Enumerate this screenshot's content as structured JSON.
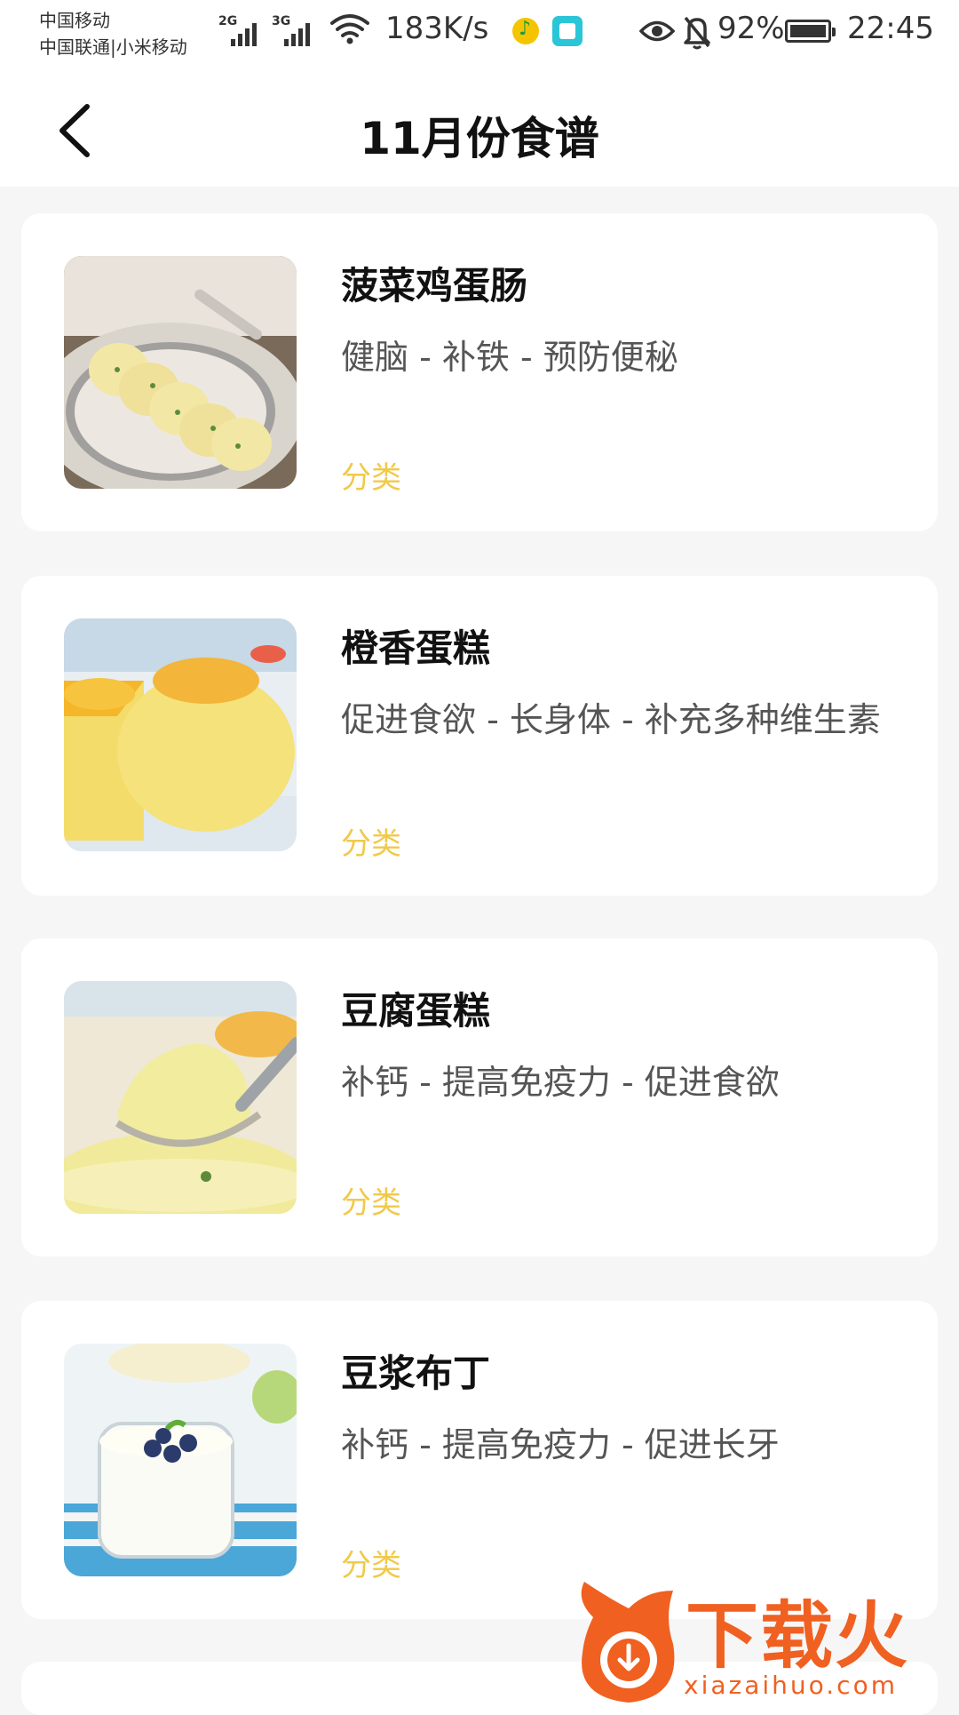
{
  "status_bar": {
    "carrier_line1": "中国移动",
    "carrier_line2": "中国联通|小米移动",
    "signal1_label": "2G",
    "signal2_label": "3G",
    "net_speed": "183K/s",
    "battery": "92%",
    "time": "22:45"
  },
  "header": {
    "title": "11月份食谱"
  },
  "recipes": [
    {
      "name": "菠菜鸡蛋肠",
      "benefits": "健脑 - 补铁 - 预防便秘",
      "category": "分类"
    },
    {
      "name": "橙香蛋糕",
      "benefits": "促进食欲 - 长身体 - 补充多种维生素",
      "category": "分类"
    },
    {
      "name": "豆腐蛋糕",
      "benefits": "补钙 - 提高免疫力 - 促进食欲",
      "category": "分类"
    },
    {
      "name": "豆浆布丁",
      "benefits": "补钙 - 提高免疫力 - 促进长牙",
      "category": "分类"
    }
  ],
  "watermark": {
    "text": "下载火",
    "url": "xiazaihuo.com"
  },
  "colors": {
    "accent": "#f1c94a",
    "background": "#f6f6f6",
    "card": "#ffffff",
    "watermark": "#f06021"
  }
}
